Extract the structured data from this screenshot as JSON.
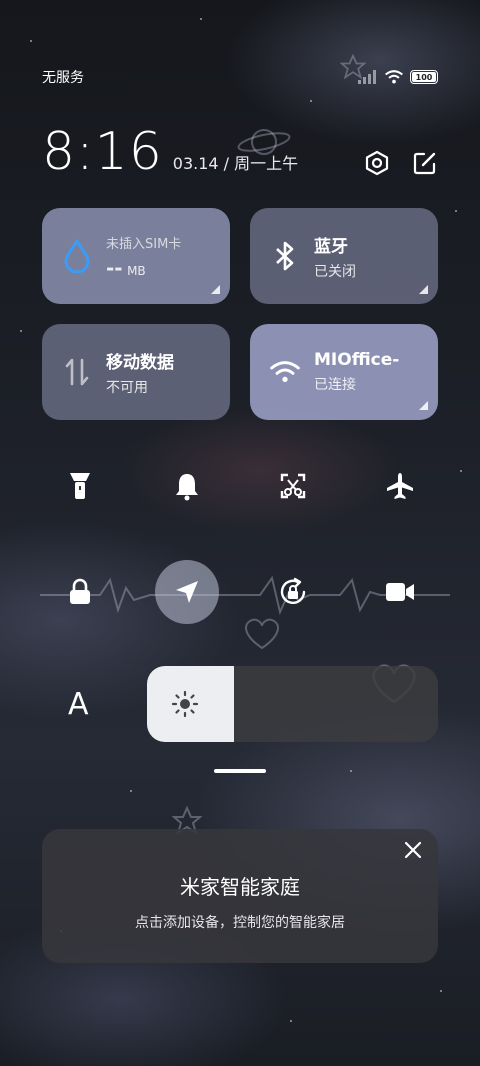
{
  "status": {
    "carrier": "无服务",
    "battery": "100"
  },
  "clock": {
    "time": "8:16",
    "date": "03.14 / 周一上午"
  },
  "tiles": {
    "data_usage": {
      "label": "未插入SIM卡",
      "value": "--",
      "unit": "MB",
      "icon": "water-drop-icon"
    },
    "bluetooth": {
      "label": "蓝牙",
      "status": "已关闭",
      "icon": "bluetooth-icon"
    },
    "mobile_data": {
      "label": "移动数据",
      "status": "不可用",
      "icon": "mobile-data-icon"
    },
    "wifi": {
      "label": "MIOffice-",
      "status": "已连接",
      "icon": "wifi-icon"
    }
  },
  "toggles_row1": [
    "flashlight-icon",
    "bell-icon",
    "screenshot-icon",
    "airplane-icon"
  ],
  "toggles_row2": [
    "lock-icon",
    "location-icon",
    "rotation-lock-icon",
    "video-camera-icon"
  ],
  "brightness": {
    "font_label": "A",
    "level": 0.3
  },
  "card": {
    "title": "米家智能家庭",
    "subtitle": "点击添加设备，控制您的智能家居"
  },
  "colors": {
    "tile_active": "#a0a6cd",
    "tile_inactive": "#787c96",
    "accent_drop": "#3a9cf5"
  }
}
